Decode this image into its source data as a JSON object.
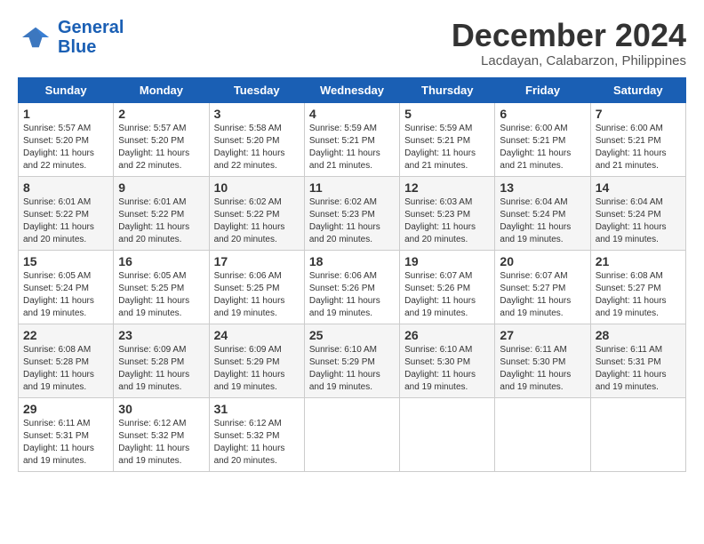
{
  "logo": {
    "line1": "General",
    "line2": "Blue"
  },
  "title": "December 2024",
  "location": "Lacdayan, Calabarzon, Philippines",
  "weekdays": [
    "Sunday",
    "Monday",
    "Tuesday",
    "Wednesday",
    "Thursday",
    "Friday",
    "Saturday"
  ],
  "weeks": [
    [
      {
        "day": "1",
        "info": "Sunrise: 5:57 AM\nSunset: 5:20 PM\nDaylight: 11 hours\nand 22 minutes."
      },
      {
        "day": "2",
        "info": "Sunrise: 5:57 AM\nSunset: 5:20 PM\nDaylight: 11 hours\nand 22 minutes."
      },
      {
        "day": "3",
        "info": "Sunrise: 5:58 AM\nSunset: 5:20 PM\nDaylight: 11 hours\nand 22 minutes."
      },
      {
        "day": "4",
        "info": "Sunrise: 5:59 AM\nSunset: 5:21 PM\nDaylight: 11 hours\nand 21 minutes."
      },
      {
        "day": "5",
        "info": "Sunrise: 5:59 AM\nSunset: 5:21 PM\nDaylight: 11 hours\nand 21 minutes."
      },
      {
        "day": "6",
        "info": "Sunrise: 6:00 AM\nSunset: 5:21 PM\nDaylight: 11 hours\nand 21 minutes."
      },
      {
        "day": "7",
        "info": "Sunrise: 6:00 AM\nSunset: 5:21 PM\nDaylight: 11 hours\nand 21 minutes."
      }
    ],
    [
      {
        "day": "8",
        "info": "Sunrise: 6:01 AM\nSunset: 5:22 PM\nDaylight: 11 hours\nand 20 minutes."
      },
      {
        "day": "9",
        "info": "Sunrise: 6:01 AM\nSunset: 5:22 PM\nDaylight: 11 hours\nand 20 minutes."
      },
      {
        "day": "10",
        "info": "Sunrise: 6:02 AM\nSunset: 5:22 PM\nDaylight: 11 hours\nand 20 minutes."
      },
      {
        "day": "11",
        "info": "Sunrise: 6:02 AM\nSunset: 5:23 PM\nDaylight: 11 hours\nand 20 minutes."
      },
      {
        "day": "12",
        "info": "Sunrise: 6:03 AM\nSunset: 5:23 PM\nDaylight: 11 hours\nand 20 minutes."
      },
      {
        "day": "13",
        "info": "Sunrise: 6:04 AM\nSunset: 5:24 PM\nDaylight: 11 hours\nand 19 minutes."
      },
      {
        "day": "14",
        "info": "Sunrise: 6:04 AM\nSunset: 5:24 PM\nDaylight: 11 hours\nand 19 minutes."
      }
    ],
    [
      {
        "day": "15",
        "info": "Sunrise: 6:05 AM\nSunset: 5:24 PM\nDaylight: 11 hours\nand 19 minutes."
      },
      {
        "day": "16",
        "info": "Sunrise: 6:05 AM\nSunset: 5:25 PM\nDaylight: 11 hours\nand 19 minutes."
      },
      {
        "day": "17",
        "info": "Sunrise: 6:06 AM\nSunset: 5:25 PM\nDaylight: 11 hours\nand 19 minutes."
      },
      {
        "day": "18",
        "info": "Sunrise: 6:06 AM\nSunset: 5:26 PM\nDaylight: 11 hours\nand 19 minutes."
      },
      {
        "day": "19",
        "info": "Sunrise: 6:07 AM\nSunset: 5:26 PM\nDaylight: 11 hours\nand 19 minutes."
      },
      {
        "day": "20",
        "info": "Sunrise: 6:07 AM\nSunset: 5:27 PM\nDaylight: 11 hours\nand 19 minutes."
      },
      {
        "day": "21",
        "info": "Sunrise: 6:08 AM\nSunset: 5:27 PM\nDaylight: 11 hours\nand 19 minutes."
      }
    ],
    [
      {
        "day": "22",
        "info": "Sunrise: 6:08 AM\nSunset: 5:28 PM\nDaylight: 11 hours\nand 19 minutes."
      },
      {
        "day": "23",
        "info": "Sunrise: 6:09 AM\nSunset: 5:28 PM\nDaylight: 11 hours\nand 19 minutes."
      },
      {
        "day": "24",
        "info": "Sunrise: 6:09 AM\nSunset: 5:29 PM\nDaylight: 11 hours\nand 19 minutes."
      },
      {
        "day": "25",
        "info": "Sunrise: 6:10 AM\nSunset: 5:29 PM\nDaylight: 11 hours\nand 19 minutes."
      },
      {
        "day": "26",
        "info": "Sunrise: 6:10 AM\nSunset: 5:30 PM\nDaylight: 11 hours\nand 19 minutes."
      },
      {
        "day": "27",
        "info": "Sunrise: 6:11 AM\nSunset: 5:30 PM\nDaylight: 11 hours\nand 19 minutes."
      },
      {
        "day": "28",
        "info": "Sunrise: 6:11 AM\nSunset: 5:31 PM\nDaylight: 11 hours\nand 19 minutes."
      }
    ],
    [
      {
        "day": "29",
        "info": "Sunrise: 6:11 AM\nSunset: 5:31 PM\nDaylight: 11 hours\nand 19 minutes."
      },
      {
        "day": "30",
        "info": "Sunrise: 6:12 AM\nSunset: 5:32 PM\nDaylight: 11 hours\nand 19 minutes."
      },
      {
        "day": "31",
        "info": "Sunrise: 6:12 AM\nSunset: 5:32 PM\nDaylight: 11 hours\nand 20 minutes."
      },
      null,
      null,
      null,
      null
    ]
  ]
}
